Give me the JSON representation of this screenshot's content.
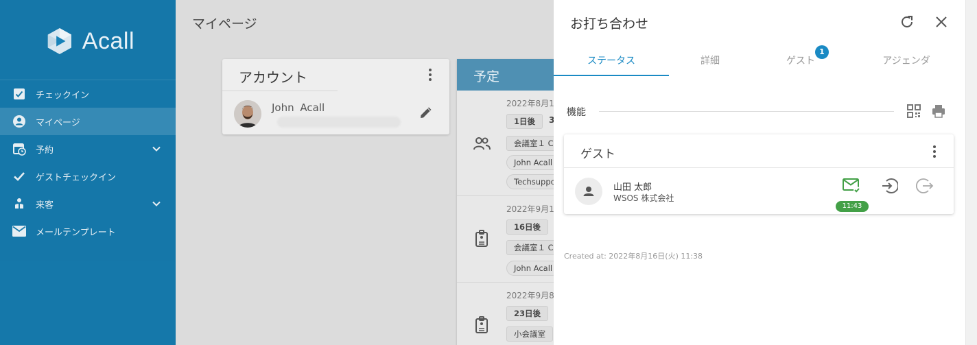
{
  "app": {
    "logo_text": "Acall"
  },
  "sidebar": {
    "items": [
      {
        "label": "チェックイン",
        "icon": "checkbox-icon"
      },
      {
        "label": "マイページ",
        "icon": "account-circle-icon"
      },
      {
        "label": "予約",
        "icon": "calendar-clock-icon"
      },
      {
        "label": "ゲストチェックイン",
        "icon": "check-icon"
      },
      {
        "label": "来客",
        "icon": "people-icon"
      },
      {
        "label": "メールテンプレート",
        "icon": "mail-icon"
      }
    ]
  },
  "main": {
    "page_title": "マイページ",
    "account_card": {
      "title": "アカウント",
      "user_name": "John   Acall"
    },
    "schedule_card": {
      "title": "予定",
      "entries": [
        {
          "date": "2022年8月1",
          "days": "1日後",
          "extra": "3",
          "room": "会議室１ C",
          "chips": [
            "John Acall",
            "Techsuppo"
          ]
        },
        {
          "date": "2022年9月1",
          "days": "16日後",
          "room": "会議室１ C",
          "chips": [
            "John Acall"
          ]
        },
        {
          "date": "2022年9月8",
          "days": "23日後",
          "room": "小会議室"
        }
      ]
    }
  },
  "drawer": {
    "title": "お打ち合わせ",
    "tabs": [
      {
        "label": "ステータス"
      },
      {
        "label": "詳細"
      },
      {
        "label": "ゲスト",
        "badge": "1"
      },
      {
        "label": "アジェンダ"
      }
    ],
    "features_label": "機能",
    "guest_card": {
      "title": "ゲスト",
      "guest_name": "山田 太郎",
      "guest_company": "WSOS 株式会社",
      "notified_time": "11:43"
    },
    "created_at": "Created at: 2022年8月16日(火) 11:38"
  },
  "colors": {
    "sidebar": "#1782b8",
    "accent": "#1a8ac4",
    "success": "#43a047"
  }
}
